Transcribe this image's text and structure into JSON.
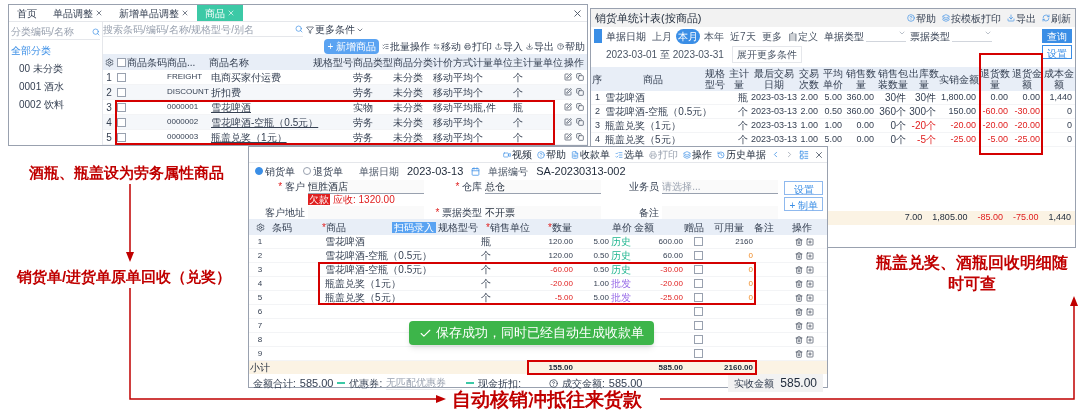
{
  "product_window": {
    "tabs": [
      {
        "label": "首页",
        "closable": false,
        "selected": false
      },
      {
        "label": "单品调整",
        "closable": true,
        "selected": false
      },
      {
        "label": "新增单品调整",
        "closable": true,
        "selected": false
      },
      {
        "label": "商品",
        "closable": true,
        "selected": true
      }
    ],
    "category_search": {
      "placeholder": "分类编码/名称"
    },
    "category_tree": [
      {
        "label": "全部分类",
        "selected": true,
        "children": [
          {
            "label": "00 未分类",
            "selected": false
          },
          {
            "label": "0001 酒水",
            "selected": false
          },
          {
            "label": "0002 饮料",
            "selected": false
          }
        ]
      }
    ],
    "search": {
      "placeholder": "搜索条码/编码/名称/规格型号/别名"
    },
    "filter_button": "更多条件",
    "primary_button": "+ 新增商品",
    "toolbar": [
      "批量操作",
      "移动",
      "打印",
      "导入",
      "导出",
      "帮助"
    ],
    "select_all_checked": false,
    "columns": [
      "商品条码",
      "商品...",
      "商品名称",
      "规格型号",
      "商品类型",
      "商品分类",
      "计价方式",
      "计量单位",
      "主计量单位",
      "操作"
    ],
    "rows": [
      {
        "index": "1",
        "checked": false,
        "code": "FREIGHT",
        "name": "电商买家付运费",
        "link": false,
        "type": "劳务",
        "category": "未分类",
        "pricing": "移动平均",
        "unit": "个",
        "main_unit": "个",
        "highlighted": false
      },
      {
        "index": "2",
        "checked": false,
        "code": "DISCOUNT",
        "name": "折扣费",
        "link": false,
        "type": "劳务",
        "category": "未分类",
        "pricing": "移动平均",
        "unit": "个",
        "main_unit": "个",
        "highlighted": false
      },
      {
        "index": "3",
        "checked": false,
        "code": "0000001",
        "name": "雪花啤酒",
        "link": true,
        "type": "实物",
        "category": "未分类",
        "pricing": "移动平均",
        "unit": "瓶,件",
        "main_unit": "瓶",
        "highlighted": true
      },
      {
        "index": "4",
        "checked": false,
        "code": "0000002",
        "name": "雪花啤酒-空瓶（0.5元）",
        "link": true,
        "type": "劳务",
        "category": "未分类",
        "pricing": "移动平均",
        "unit": "个",
        "main_unit": "个",
        "highlighted": true
      },
      {
        "index": "5",
        "checked": false,
        "code": "0000003",
        "name": "瓶盖兑奖（1元）",
        "link": true,
        "type": "劳务",
        "category": "未分类",
        "pricing": "移动平均",
        "unit": "个",
        "main_unit": "个",
        "highlighted": true
      }
    ]
  },
  "report_window": {
    "title": "销货单统计表(按商品)",
    "actions": [
      "帮助",
      "按模板打印",
      "导出",
      "刷新"
    ],
    "date_filter": {
      "label": "单据日期",
      "options": [
        {
          "label": "上月",
          "selected": false
        },
        {
          "label": "本月",
          "selected": true
        },
        {
          "label": "本年",
          "selected": false
        },
        {
          "label": "近7天",
          "selected": false
        },
        {
          "label": "更多",
          "selected": false
        },
        {
          "label": "自定义",
          "selected": false
        }
      ],
      "range": "2023-03-01 至 2023-03-31"
    },
    "selects": [
      {
        "label": "单据类型"
      },
      {
        "label": "票据类型"
      }
    ],
    "buttons": [
      "查询",
      "设置"
    ],
    "more_conditions": "展开更多条件",
    "columns": [
      {
        "label": "序",
        "highlighted": false
      },
      {
        "label": "商品",
        "highlighted": false
      },
      {
        "label": "规格型号",
        "highlighted": false
      },
      {
        "label": "主计量",
        "highlighted": false
      },
      {
        "label": "最后交易日期",
        "highlighted": false
      },
      {
        "label": "交易次数",
        "highlighted": false
      },
      {
        "label": "平均单价",
        "highlighted": false
      },
      {
        "label": "销售数量",
        "highlighted": false
      },
      {
        "label": "销售包装数量",
        "highlighted": false
      },
      {
        "label": "出库数量",
        "highlighted": false
      },
      {
        "label": "实销金额",
        "highlighted": false
      },
      {
        "label": "退货数量",
        "highlighted": true
      },
      {
        "label": "退货金额",
        "highlighted": true
      },
      {
        "label": "成本金额",
        "highlighted": false
      }
    ],
    "rows": [
      {
        "index": "1",
        "product": "雪花啤酒",
        "unit": "瓶",
        "last_date": "2023-03-13",
        "count": "2.00",
        "avg_price": "5.00",
        "sales_qty": "360.00",
        "pack_qty": "30件",
        "out_qty": {
          "text": "30件",
          "negative": false
        },
        "amount": {
          "text": "1,800.00",
          "negative": false
        },
        "return_qty": {
          "text": "0.00",
          "negative": false
        },
        "return_amount": {
          "text": "0.00",
          "negative": false
        },
        "cost": "1,440"
      },
      {
        "index": "2",
        "product": "雪花啤酒-空瓶（0.5元）",
        "unit": "个",
        "last_date": "2023-03-13",
        "count": "2.00",
        "avg_price": "0.50",
        "sales_qty": "360.00",
        "pack_qty": "360个",
        "out_qty": {
          "text": "300个",
          "negative": false
        },
        "amount": {
          "text": "150.00",
          "negative": false
        },
        "return_qty": {
          "text": "-60.00",
          "negative": true
        },
        "return_amount": {
          "text": "-30.00",
          "negative": true
        },
        "cost": "0"
      },
      {
        "index": "3",
        "product": "瓶盖兑奖（1元）",
        "unit": "个",
        "last_date": "2023-03-13",
        "count": "1.00",
        "avg_price": "1.00",
        "sales_qty": "0.00",
        "pack_qty": "0个",
        "out_qty": {
          "text": "-20个",
          "negative": true
        },
        "amount": {
          "text": "-20.00",
          "negative": true
        },
        "return_qty": {
          "text": "-20.00",
          "negative": true
        },
        "return_amount": {
          "text": "-20.00",
          "negative": true
        },
        "cost": "0"
      },
      {
        "index": "4",
        "product": "瓶盖兑奖（5元）",
        "unit": "个",
        "last_date": "2023-03-13",
        "count": "1.00",
        "avg_price": "5.00",
        "sales_qty": "0.00",
        "pack_qty": "0个",
        "out_qty": {
          "text": "-5个",
          "negative": true
        },
        "amount": {
          "text": "-25.00",
          "negative": true
        },
        "return_qty": {
          "text": "-5.00",
          "negative": true
        },
        "return_amount": {
          "text": "-25.00",
          "negative": true
        },
        "cost": "0"
      }
    ],
    "totals": [
      {
        "text": "7.00",
        "negative": false
      },
      {
        "text": "1,805.00",
        "negative": false
      },
      {
        "text": "-85.00",
        "negative": true
      },
      {
        "text": "-75.00",
        "negative": true
      },
      {
        "text": "1,440",
        "negative": false
      }
    ]
  },
  "order_window": {
    "doc_types": [
      {
        "label": "销货单",
        "selected": true
      },
      {
        "label": "退货单",
        "selected": false
      }
    ],
    "date": {
      "label": "单据日期",
      "value": "2023-03-13"
    },
    "number": {
      "label": "单据编号",
      "value": "SA-20230313-002"
    },
    "actions": [
      {
        "label": "视频",
        "disabled": false
      },
      {
        "label": "帮助",
        "disabled": false
      },
      {
        "label": "收款单",
        "disabled": false
      },
      {
        "label": "选单",
        "disabled": false
      },
      {
        "label": "打印",
        "disabled": true
      },
      {
        "label": "操作",
        "disabled": false
      },
      {
        "label": "历史单据",
        "disabled": false
      }
    ],
    "required_mark": "*",
    "fields": [
      {
        "label": "客户",
        "required": true,
        "value": "恒胜酒店"
      },
      {
        "label": "仓库",
        "required": true,
        "value": "总仓"
      },
      {
        "label": "业务员",
        "required": false,
        "placeholder": "请选择..."
      },
      {
        "label": "客户地址",
        "required": false
      },
      {
        "label": "票据类型",
        "required": true,
        "value": "不开票"
      },
      {
        "label": "备注",
        "required": false
      }
    ],
    "debt_badge": "欠款",
    "receivable": "应收: 1320.00",
    "side_buttons": [
      "设置",
      "+ 制单"
    ],
    "scan_badge": "扫码录入",
    "columns": [
      {
        "label": "条码",
        "required": false
      },
      {
        "label": "商品",
        "required": true
      },
      {
        "label": "规格型号",
        "required": false
      },
      {
        "label": "销售单位",
        "required": true
      },
      {
        "label": "数量",
        "required": true
      },
      {
        "label": "单价",
        "required": false
      },
      {
        "label": "金额",
        "required": false
      },
      {
        "label": "赠品",
        "required": false
      },
      {
        "label": "可用量",
        "required": false
      },
      {
        "label": "备注",
        "required": false
      },
      {
        "label": "操作",
        "required": false
      }
    ],
    "rows": [
      {
        "index": "1",
        "product": "雪花啤酒",
        "unit": "瓶",
        "qty": "120.00",
        "price": "5.00",
        "price_tag": {
          "text": "历史",
          "kind": "history"
        },
        "amount": "600.00",
        "gift_checked": false,
        "available": "2160",
        "return": false,
        "stock_warning": false,
        "highlighted": false
      },
      {
        "index": "2",
        "product": "雪花啤酒-空瓶（0.5元）",
        "unit": "个",
        "qty": "120.00",
        "price": "0.50",
        "price_tag": {
          "text": "历史",
          "kind": "history"
        },
        "amount": "60.00",
        "gift_checked": false,
        "available": "0",
        "return": false,
        "stock_warning": true,
        "highlighted": false
      },
      {
        "index": "3",
        "product": "雪花啤酒-空瓶（0.5元）",
        "unit": "个",
        "qty": "-60.00",
        "price": "0.50",
        "price_tag": {
          "text": "历史",
          "kind": "history"
        },
        "amount": "-30.00",
        "gift_checked": false,
        "available": "0",
        "return": true,
        "stock_warning": true,
        "highlighted": true
      },
      {
        "index": "4",
        "product": "瓶盖兑奖（1元）",
        "unit": "个",
        "qty": "-20.00",
        "price": "1.00",
        "price_tag": {
          "text": "批发",
          "kind": "wholesale"
        },
        "amount": "-20.00",
        "gift_checked": false,
        "available": "0",
        "return": true,
        "stock_warning": true,
        "highlighted": true
      },
      {
        "index": "5",
        "product": "瓶盖兑奖（5元）",
        "unit": "个",
        "qty": "-5.00",
        "price": "5.00",
        "price_tag": {
          "text": "批发",
          "kind": "wholesale"
        },
        "amount": "-25.00",
        "gift_checked": false,
        "available": "0",
        "return": true,
        "stock_warning": true,
        "highlighted": true
      },
      {
        "index": "6",
        "gift_checked": false
      },
      {
        "index": "7",
        "gift_checked": false
      },
      {
        "index": "8",
        "gift_checked": false
      },
      {
        "index": "9",
        "gift_checked": false
      }
    ],
    "subtotal": {
      "label": "小计",
      "qty": "155.00",
      "amount": "585.00",
      "available": "2160.00",
      "highlighted": true
    },
    "footer": {
      "total_label": "金额合计:",
      "total": "585.00",
      "coupon_label": "优惠券:",
      "coupon_placeholder": "无匹配优惠券",
      "discount_label": "现金折扣:",
      "deal_label": "成交金额:",
      "deal": "585.00",
      "received_label": "实收金额",
      "received": "585.00"
    },
    "toast": "保存成功，同时已经自动生成收款单"
  },
  "annotations": [
    {
      "text": "酒瓶、瓶盖设为劳务属性商品"
    },
    {
      "text": "销货单/进货单原单回收（兑奖）"
    },
    {
      "text": "瓶盖兑奖、酒瓶回收明细随时可查"
    },
    {
      "text": "自动核销冲抵往来货款"
    }
  ]
}
